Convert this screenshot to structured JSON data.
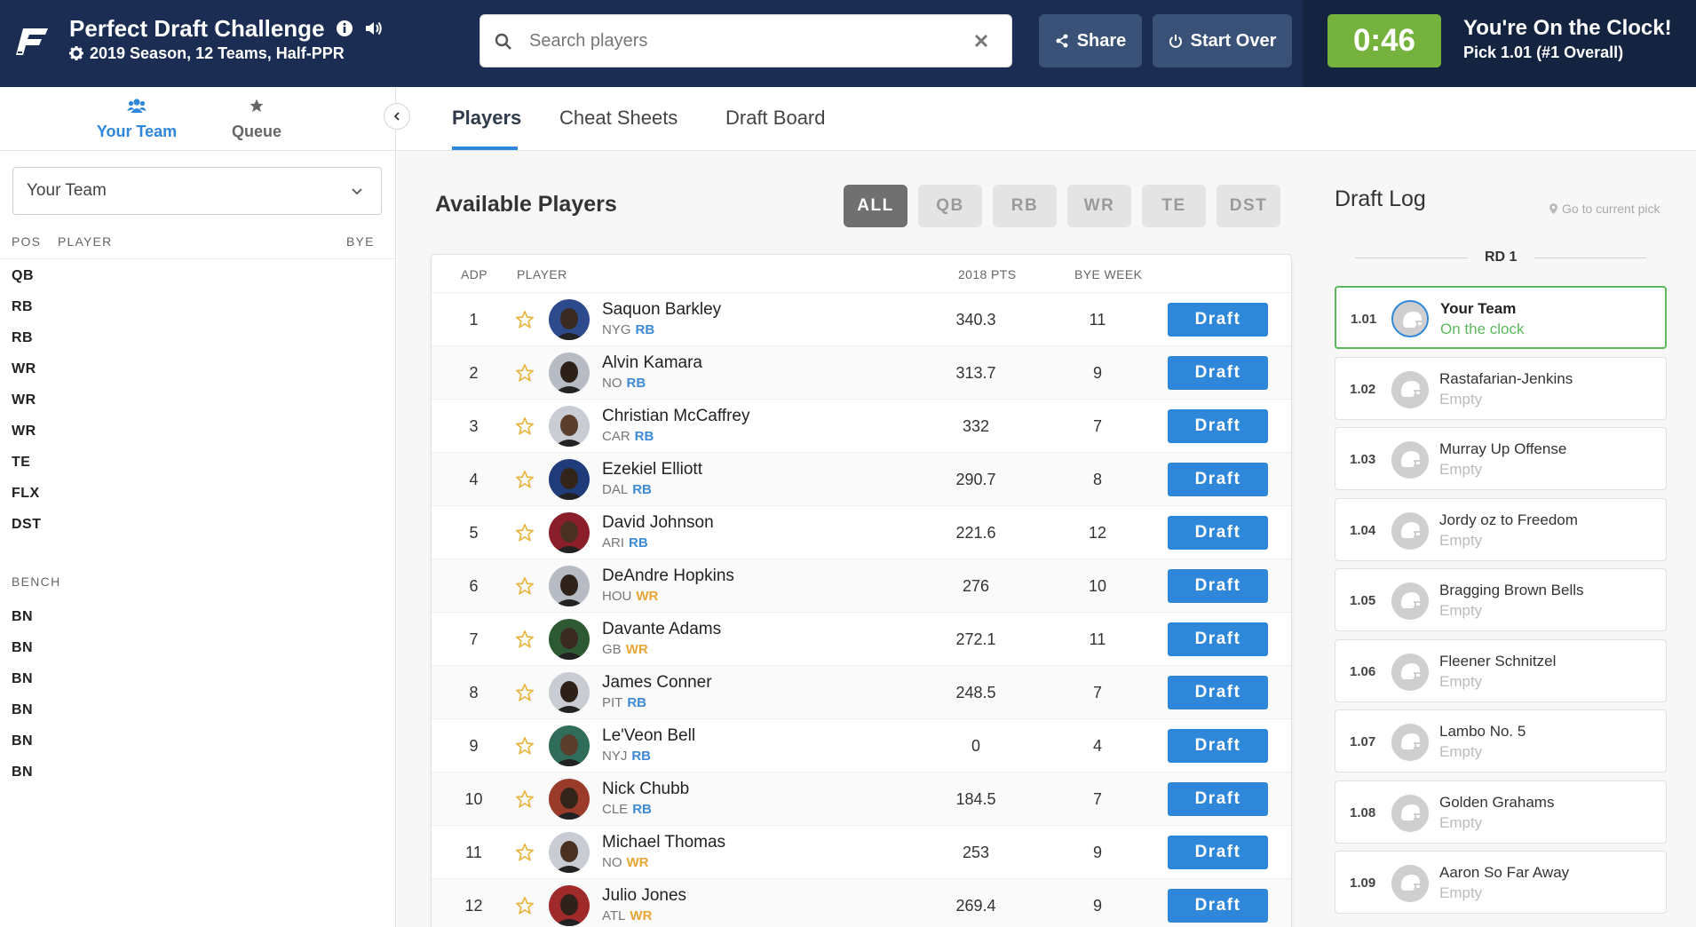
{
  "header": {
    "title": "Perfect Draft Challenge",
    "subtitle": "2019 Season, 12 Teams, Half-PPR",
    "search_placeholder": "Search players",
    "share_label": "Share",
    "start_over_label": "Start Over",
    "timer": "0:46",
    "on_clock_title": "You're On the Clock!",
    "on_clock_sub": "Pick 1.01 (#1 Overall)",
    "colors": {
      "navy": "#1b2d52",
      "clock_bg": "#142340",
      "timer_green": "#74b23d"
    }
  },
  "sidebar": {
    "tabs": [
      {
        "label": "Your Team",
        "icon": "users-icon"
      },
      {
        "label": "Queue",
        "icon": "star-icon"
      }
    ],
    "team_select_value": "Your Team",
    "roster_headers": {
      "pos": "POS",
      "player": "PLAYER",
      "bye": "BYE"
    },
    "starters": [
      "QB",
      "RB",
      "RB",
      "WR",
      "WR",
      "WR",
      "TE",
      "FLX",
      "DST"
    ],
    "bench_label": "BENCH",
    "bench": [
      "BN",
      "BN",
      "BN",
      "BN",
      "BN",
      "BN"
    ]
  },
  "main_tabs": [
    "Players",
    "Cheat Sheets",
    "Draft Board"
  ],
  "available": {
    "title": "Available Players",
    "position_filters": [
      "ALL",
      "QB",
      "RB",
      "WR",
      "TE",
      "DST"
    ],
    "active_filter": "ALL",
    "columns": {
      "adp": "ADP",
      "player": "PLAYER",
      "pts": "2018 PTS",
      "bye": "BYE WEEK"
    },
    "draft_label": "Draft",
    "position_colors": {
      "RB": "#3d8ad6",
      "WR": "#e8a634"
    },
    "players": [
      {
        "adp": "1",
        "name": "Saquon Barkley",
        "team": "NYG",
        "pos": "RB",
        "pts": "340.3",
        "bye": "11"
      },
      {
        "adp": "2",
        "name": "Alvin Kamara",
        "team": "NO",
        "pos": "RB",
        "pts": "313.7",
        "bye": "9"
      },
      {
        "adp": "3",
        "name": "Christian McCaffrey",
        "team": "CAR",
        "pos": "RB",
        "pts": "332",
        "bye": "7"
      },
      {
        "adp": "4",
        "name": "Ezekiel Elliott",
        "team": "DAL",
        "pos": "RB",
        "pts": "290.7",
        "bye": "8"
      },
      {
        "adp": "5",
        "name": "David Johnson",
        "team": "ARI",
        "pos": "RB",
        "pts": "221.6",
        "bye": "12"
      },
      {
        "adp": "6",
        "name": "DeAndre Hopkins",
        "team": "HOU",
        "pos": "WR",
        "pts": "276",
        "bye": "10"
      },
      {
        "adp": "7",
        "name": "Davante Adams",
        "team": "GB",
        "pos": "WR",
        "pts": "272.1",
        "bye": "11"
      },
      {
        "adp": "8",
        "name": "James Conner",
        "team": "PIT",
        "pos": "RB",
        "pts": "248.5",
        "bye": "7"
      },
      {
        "adp": "9",
        "name": "Le'Veon Bell",
        "team": "NYJ",
        "pos": "RB",
        "pts": "0",
        "bye": "4"
      },
      {
        "adp": "10",
        "name": "Nick Chubb",
        "team": "CLE",
        "pos": "RB",
        "pts": "184.5",
        "bye": "7"
      },
      {
        "adp": "11",
        "name": "Michael Thomas",
        "team": "NO",
        "pos": "WR",
        "pts": "253",
        "bye": "9"
      },
      {
        "adp": "12",
        "name": "Julio Jones",
        "team": "ATL",
        "pos": "WR",
        "pts": "269.4",
        "bye": "9"
      }
    ]
  },
  "draft_log": {
    "title": "Draft Log",
    "go_to_current": "Go to current pick",
    "round_label": "RD 1",
    "picks": [
      {
        "num": "1.01",
        "team": "Your Team",
        "status": "On the clock",
        "current": true
      },
      {
        "num": "1.02",
        "team": "Rastafarian-Jenkins",
        "status": "Empty"
      },
      {
        "num": "1.03",
        "team": "Murray Up Offense",
        "status": "Empty"
      },
      {
        "num": "1.04",
        "team": "Jordy oz to Freedom",
        "status": "Empty"
      },
      {
        "num": "1.05",
        "team": "Bragging Brown Bells",
        "status": "Empty"
      },
      {
        "num": "1.06",
        "team": "Fleener Schnitzel",
        "status": "Empty"
      },
      {
        "num": "1.07",
        "team": "Lambo No. 5",
        "status": "Empty"
      },
      {
        "num": "1.08",
        "team": "Golden Grahams",
        "status": "Empty"
      },
      {
        "num": "1.09",
        "team": "Aaron So Far Away",
        "status": "Empty"
      }
    ]
  }
}
